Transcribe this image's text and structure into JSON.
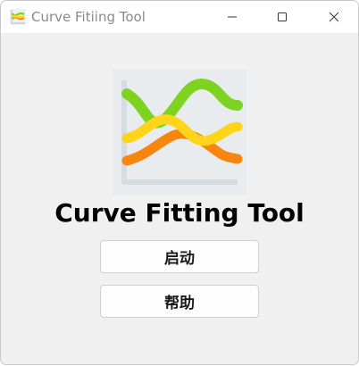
{
  "window": {
    "title": "Curve Fitiing Tool"
  },
  "main": {
    "heading": "Curve Fitting Tool",
    "start_button_label": "启动",
    "help_button_label": "帮助"
  },
  "icons": {
    "app": "curve-chart-icon",
    "minimize": "minimize-icon",
    "maximize": "maximize-icon",
    "close": "close-icon",
    "logo": "curve-chart-logo"
  },
  "colors": {
    "curve_green": "#7ed321",
    "curve_yellow": "#ffd51c",
    "curve_orange": "#f7860f",
    "axis": "#d5dde3"
  }
}
